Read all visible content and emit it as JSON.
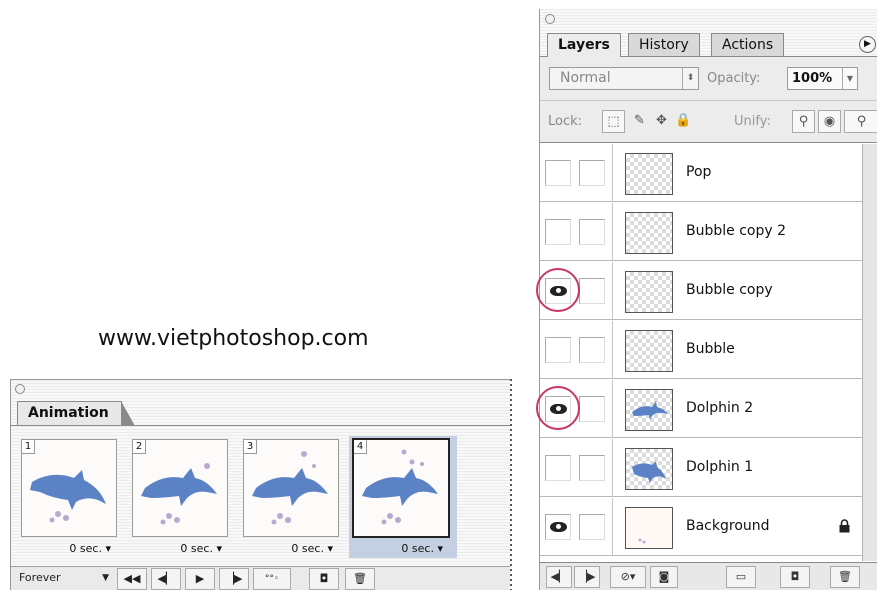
{
  "watermark": "www.vietphotoshop.com",
  "animation_panel": {
    "tab_label": "Animation",
    "frames": [
      {
        "number": "1",
        "delay": "0 sec.",
        "selected": false
      },
      {
        "number": "2",
        "delay": "0 sec.",
        "selected": false
      },
      {
        "number": "3",
        "delay": "0 sec.",
        "selected": false
      },
      {
        "number": "4",
        "delay": "0 sec.",
        "selected": true
      }
    ],
    "loop_option": "Forever",
    "toolbar_icons": [
      "first-frame-icon",
      "previous-frame-icon",
      "play-icon",
      "next-frame-icon",
      "tween-icon",
      "duplicate-frame-icon",
      "delete-frame-icon"
    ]
  },
  "layers_panel": {
    "tabs": [
      {
        "label": "Layers",
        "active": true
      },
      {
        "label": "History",
        "active": false
      },
      {
        "label": "Actions",
        "active": false
      }
    ],
    "blend_mode": "Normal",
    "opacity_label": "Opacity:",
    "opacity_value": "100%",
    "lock_label": "Lock:",
    "unify_label": "Unify:",
    "layers": [
      {
        "name": "Pop",
        "visible": false,
        "locked": false
      },
      {
        "name": "Bubble copy 2",
        "visible": false,
        "locked": false
      },
      {
        "name": "Bubble copy",
        "visible": true,
        "locked": false
      },
      {
        "name": "Bubble",
        "visible": false,
        "locked": false
      },
      {
        "name": "Dolphin 2",
        "visible": true,
        "locked": false
      },
      {
        "name": "Dolphin 1",
        "visible": false,
        "locked": false
      },
      {
        "name": "Background",
        "visible": true,
        "locked": true
      }
    ],
    "highlight_color": "#c8356a",
    "selected_frame_color": "#c4cfe2",
    "dolphin_color": "#5b82c4"
  }
}
